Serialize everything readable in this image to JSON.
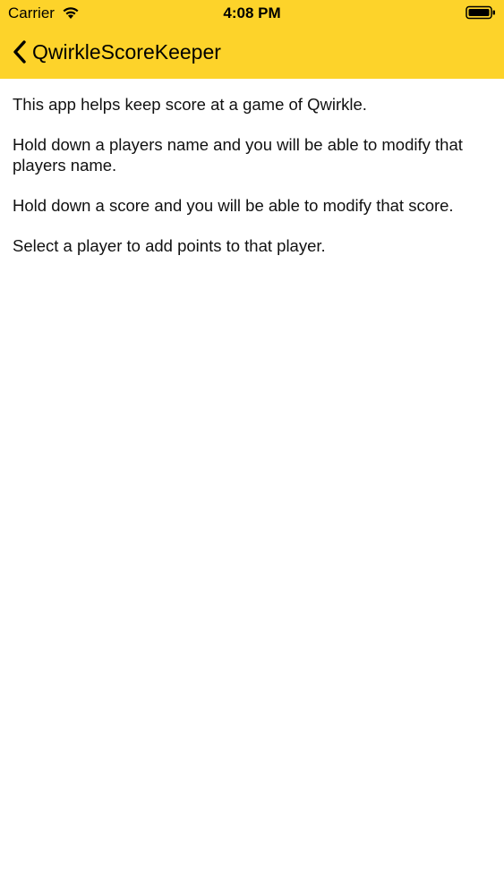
{
  "status_bar": {
    "carrier": "Carrier",
    "time": "4:08 PM",
    "wifi_icon": "wifi-icon",
    "battery_icon": "battery-icon"
  },
  "nav": {
    "back_label": "QwirkleScoreKeeper",
    "back_icon": "chevron-left-icon",
    "bar_color": "#FDD32A"
  },
  "help": {
    "paragraphs": [
      "This app helps keep score at a game of Qwirkle.",
      "Hold down a players name and you will be able to modify that players name.",
      "Hold down a score and you will be able to modify that score.",
      "Select a player to add points to that player."
    ]
  }
}
